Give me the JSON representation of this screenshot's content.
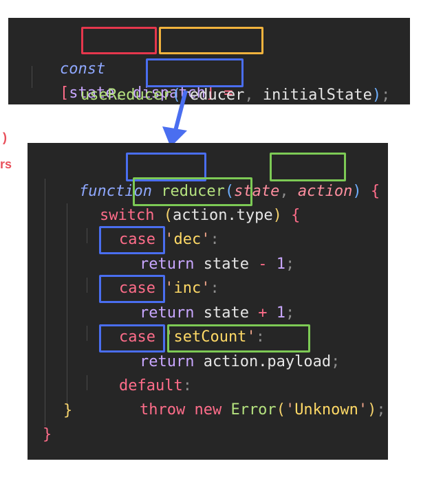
{
  "side_labels": {
    "line1": ")",
    "line2": "rs"
  },
  "top_code": {
    "line1": {
      "const": "const",
      "open": "[",
      "state": "state",
      "comma": ",",
      "dispatch": "dispatch",
      "close": "]",
      "eq": " ="
    },
    "line2": {
      "fn": "useReducer",
      "open": "(",
      "reducer": "reducer",
      "comma": ",",
      "initial": " initialState",
      "close": ")",
      "semi": ";"
    }
  },
  "bottom_code": {
    "l1": {
      "function": "function",
      "name": "reducer",
      "open": "(",
      "state": "state",
      "comma": ", ",
      "action": "action",
      "close": ")",
      "brace": " {"
    },
    "l2": {
      "switch": "switch",
      "open": "(",
      "expr": "action.type",
      "close": ")",
      "brace": " {"
    },
    "l3": {
      "case": "case",
      "q1": "'",
      "val": "dec",
      "q2": "'",
      "colon": ":"
    },
    "l4": {
      "ret": "return",
      "expr": " state",
      "op": " -",
      "num": " 1",
      "semi": ";"
    },
    "l5": {
      "case": "case",
      "q1": "'",
      "val": "inc",
      "q2": "'",
      "colon": ":"
    },
    "l6": {
      "ret": "return",
      "expr": " state",
      "op": " +",
      "num": " 1",
      "semi": ";"
    },
    "l7": {
      "case": "case",
      "q1": "'",
      "val": "setCount",
      "q2": "'",
      "colon": ":"
    },
    "l8": {
      "ret": "return",
      "expr": "action.payload",
      "semi": ";"
    },
    "l9": {
      "default": "default",
      "colon": ":"
    },
    "l10": {
      "throw": "throw",
      "new": " new",
      "err": " Error",
      "open": "(",
      "q1": "'",
      "val": "Unknown",
      "q2": "'",
      "close": ")",
      "semi": ";"
    },
    "l11": {
      "brace": "}"
    },
    "l12": {
      "brace": "}"
    }
  },
  "colors": {
    "state_box": "#e6374d",
    "dispatch_box": "#f2b33d",
    "reducer_box": "#4a6ef0",
    "action_box": "#7dca55",
    "arrow": "#4a6ef0"
  }
}
